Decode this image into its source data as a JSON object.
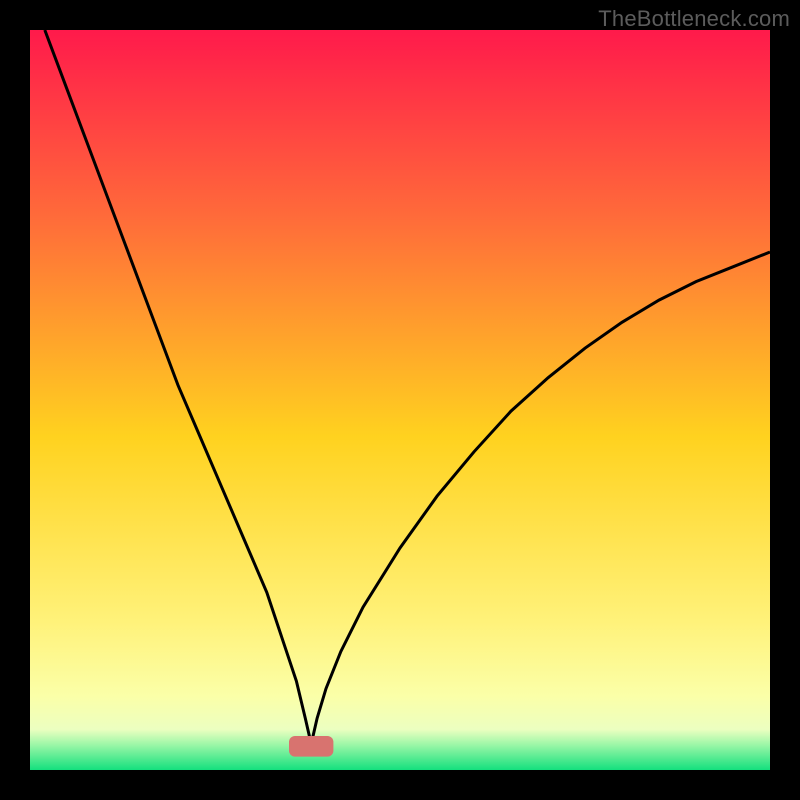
{
  "watermark": {
    "text": "TheBottleneck.com"
  },
  "chart_data": {
    "type": "line",
    "title": "",
    "xlabel": "",
    "ylabel": "",
    "xlim": [
      0,
      100
    ],
    "ylim": [
      0,
      100
    ],
    "grid": false,
    "legend": false,
    "background_gradient": {
      "stops": [
        {
          "offset": 0.0,
          "color": "#ff1a4b"
        },
        {
          "offset": 0.25,
          "color": "#ff6a3a"
        },
        {
          "offset": 0.55,
          "color": "#ffd21f"
        },
        {
          "offset": 0.8,
          "color": "#fff27a"
        },
        {
          "offset": 0.9,
          "color": "#fbffa8"
        },
        {
          "offset": 0.945,
          "color": "#ecffc0"
        },
        {
          "offset": 0.965,
          "color": "#9ff7a8"
        },
        {
          "offset": 1.0,
          "color": "#14e07e"
        }
      ]
    },
    "optimal_marker": {
      "x": 38,
      "width": 6,
      "color": "#d8736f",
      "y": 3.2,
      "height": 2.8
    },
    "series": [
      {
        "name": "bottleneck-curve",
        "color": "#000000",
        "x": [
          2,
          5,
          8,
          11,
          14,
          17,
          20,
          23,
          26,
          29,
          32,
          34,
          36,
          37.2,
          38,
          38.8,
          40,
          42,
          45,
          50,
          55,
          60,
          65,
          70,
          75,
          80,
          85,
          90,
          95,
          100
        ],
        "y": [
          100,
          92,
          84,
          76,
          68,
          60,
          52,
          45,
          38,
          31,
          24,
          18,
          12,
          7,
          3.5,
          7,
          11,
          16,
          22,
          30,
          37,
          43,
          48.5,
          53,
          57,
          60.5,
          63.5,
          66,
          68,
          70
        ]
      }
    ]
  }
}
